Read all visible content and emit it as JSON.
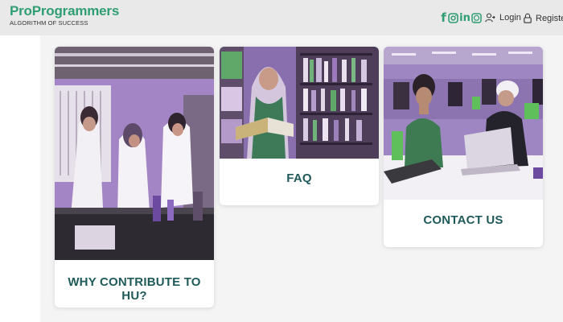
{
  "brand": {
    "name": "ProProgrammers",
    "tagline": "ALGORITHM OF SUCCESS"
  },
  "social": {
    "facebook_glyph": "f",
    "linkedin_glyph": "in",
    "icons": [
      "facebook-icon",
      "instagram-icon",
      "linkedin-icon",
      "whatsapp-icon"
    ]
  },
  "nav": {
    "login": "Login",
    "register": "Register"
  },
  "cards": [
    {
      "label": "WHY CONTRIBUTE TO HU?",
      "image": "lab-students-photo"
    },
    {
      "label": "FAQ",
      "image": "library-reader-photo"
    },
    {
      "label": "CONTACT US",
      "image": "students-laptop-photo"
    }
  ],
  "colors": {
    "accent": "#2f9e73",
    "card_label": "#1f5a5a",
    "header_bg": "#e9e9e9",
    "photo_tint": "#9a6ad6"
  }
}
